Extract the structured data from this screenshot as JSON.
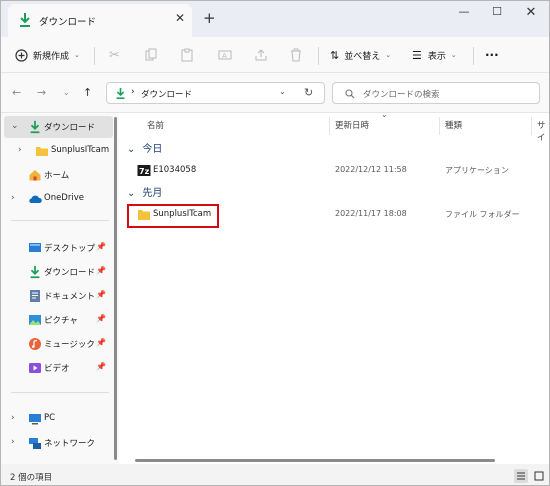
{
  "window": {
    "tab_title": "ダウンロード",
    "new_tab": "+",
    "controls": {
      "minimize": "—",
      "maximize": "☐",
      "close": "✕"
    }
  },
  "toolbar": {
    "new_label": "新規作成",
    "sort_label": "並べ替え",
    "view_label": "表示",
    "more_label": "···"
  },
  "address": {
    "path_separator": "›",
    "path_current": "ダウンロード",
    "search_placeholder": "ダウンロードの検索"
  },
  "sidebar": {
    "items": [
      {
        "label": "ダウンロード",
        "icon": "download-icon",
        "expanded": true,
        "selected": true
      },
      {
        "label": "SunplusITcam",
        "icon": "folder-icon"
      },
      {
        "label": "ホーム",
        "icon": "home-icon"
      },
      {
        "label": "OneDrive",
        "icon": "cloud-icon"
      },
      {
        "label": "デスクトップ",
        "icon": "desktop-icon",
        "pinned": true
      },
      {
        "label": "ダウンロード",
        "icon": "download-icon",
        "pinned": true
      },
      {
        "label": "ドキュメント",
        "icon": "document-icon",
        "pinned": true
      },
      {
        "label": "ピクチャ",
        "icon": "pictures-icon",
        "pinned": true
      },
      {
        "label": "ミュージック",
        "icon": "music-icon",
        "pinned": true
      },
      {
        "label": "ビデオ",
        "icon": "video-icon",
        "pinned": true
      },
      {
        "label": "PC",
        "icon": "pc-icon"
      },
      {
        "label": "ネットワーク",
        "icon": "network-icon"
      }
    ]
  },
  "columns": {
    "name": "名前",
    "modified": "更新日時",
    "type": "種類",
    "size": "サイ"
  },
  "groups": [
    {
      "label": "今日",
      "files": [
        {
          "name": "E1034058",
          "modified": "2022/12/12 11:58",
          "type": "アプリケーション",
          "icon": "application-icon"
        }
      ]
    },
    {
      "label": "先月",
      "files": [
        {
          "name": "SunplusITcam",
          "modified": "2022/11/17 18:08",
          "type": "ファイル フォルダー",
          "icon": "folder-icon",
          "highlighted": true
        }
      ]
    }
  ],
  "status": {
    "item_count": "2 個の項目"
  },
  "colors": {
    "accent_download": "#1a9f5a",
    "folder": "#f5c33b",
    "highlight_border": "#d10d13"
  }
}
